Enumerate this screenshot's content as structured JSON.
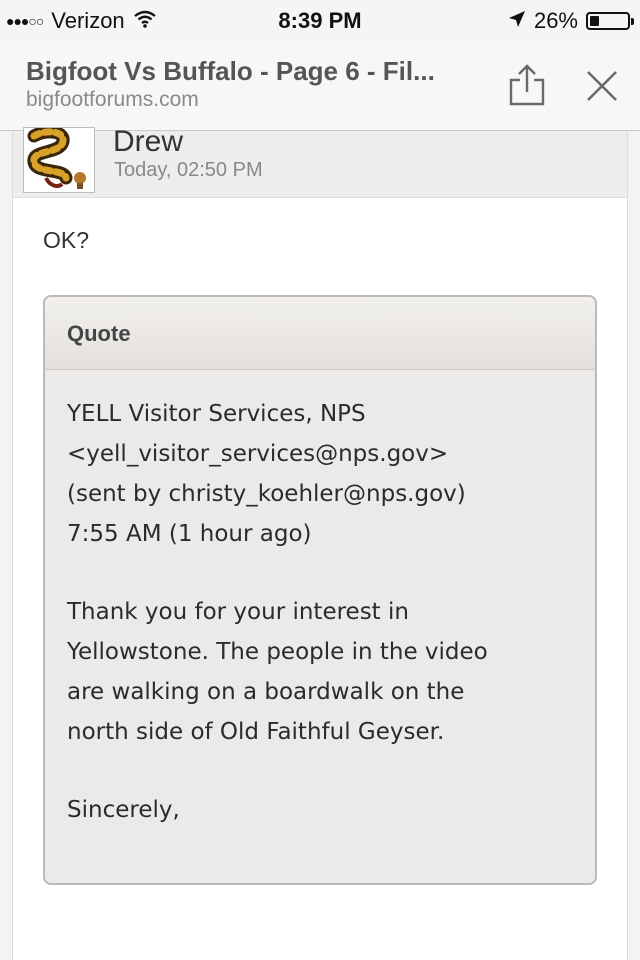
{
  "status_bar": {
    "signal_dots": "●●●○○",
    "carrier": "Verizon",
    "time": "8:39 PM",
    "battery_percent": "26%",
    "battery_level": 0.26
  },
  "browser": {
    "title": "Bigfoot Vs Buffalo - Page 6 - Fil...",
    "url": "bigfootforums.com"
  },
  "post": {
    "author": "Drew",
    "timestamp": "Today, 02:50 PM",
    "text": "OK?",
    "quote": {
      "label": "Quote",
      "lines_1": [
        "YELL Visitor Services, NPS",
        "<yell_visitor_services@nps.gov>",
        "(sent by christy_koehler@nps.gov)",
        "7:55 AM (1 hour ago)"
      ],
      "lines_2": [
        "Thank you for your interest in",
        "Yellowstone. The people in the video",
        "are walking on a boardwalk on the",
        "north side of Old Faithful Geyser."
      ],
      "lines_3": [
        "Sincerely,"
      ]
    }
  },
  "colors": {
    "status_bg": "#f5f5f5",
    "nav_bg": "#f7f7f7",
    "post_header_bg": "#efedeb",
    "quote_bg": "#eceae8"
  }
}
